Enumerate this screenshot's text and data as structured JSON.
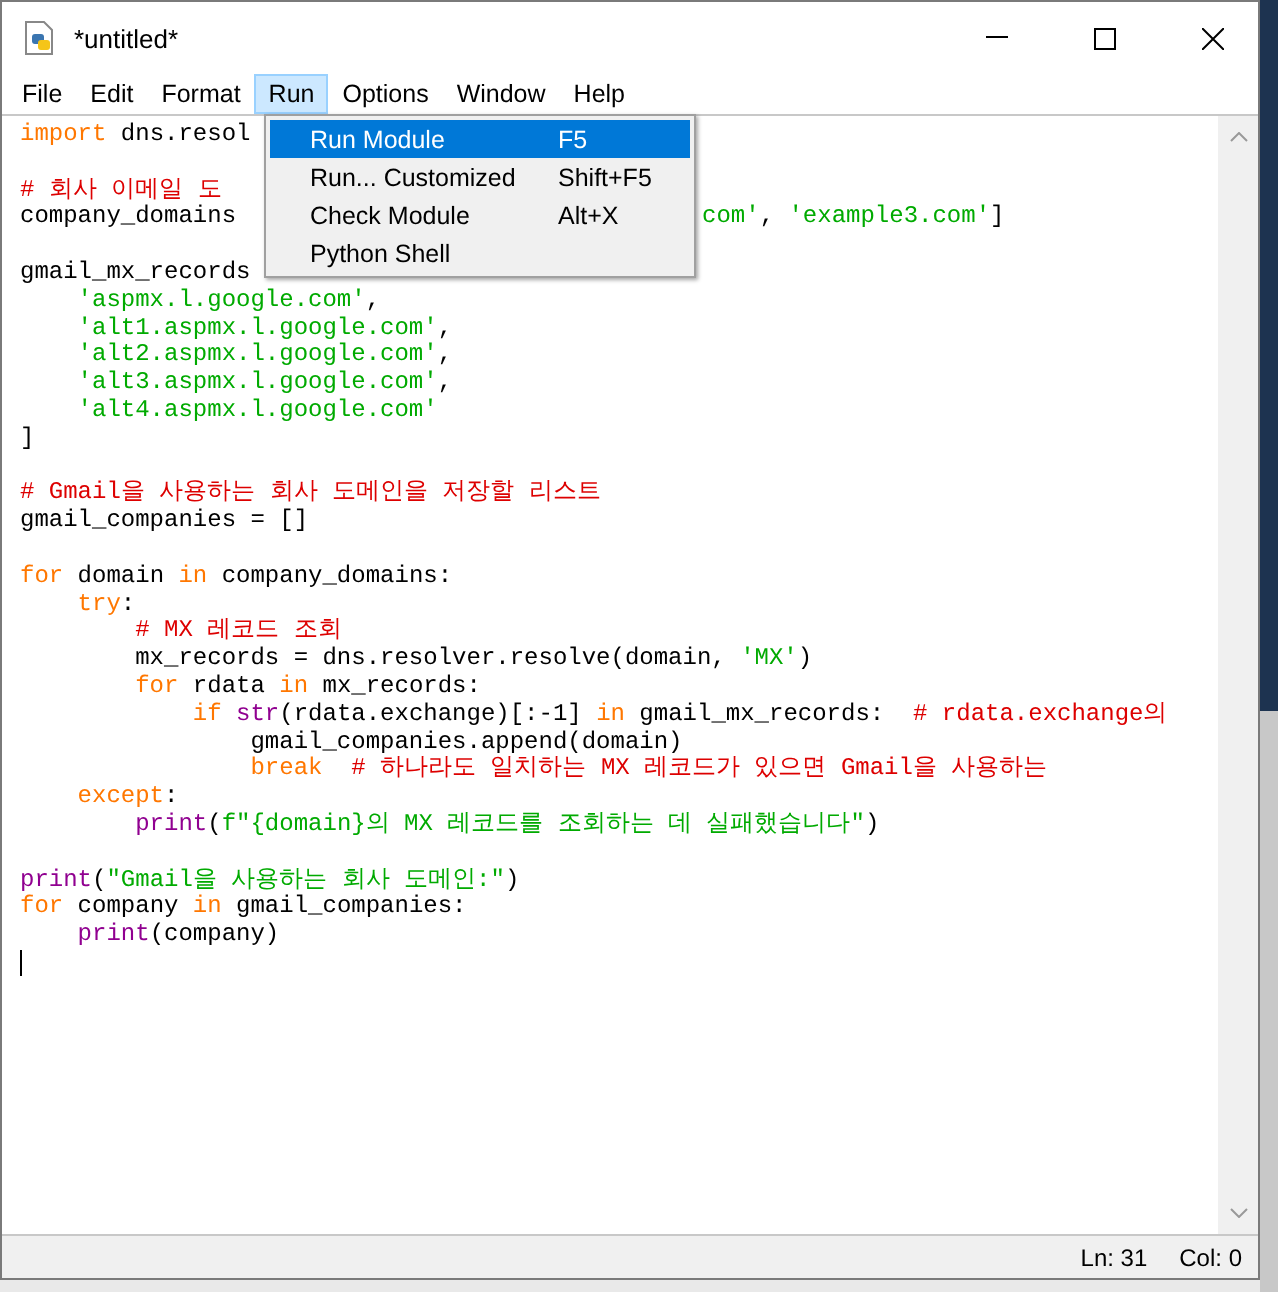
{
  "window": {
    "title": "*untitled*"
  },
  "menu_bar": [
    {
      "label": "File",
      "selected": false
    },
    {
      "label": "Edit",
      "selected": false
    },
    {
      "label": "Format",
      "selected": false
    },
    {
      "label": "Run",
      "selected": true
    },
    {
      "label": "Options",
      "selected": false
    },
    {
      "label": "Window",
      "selected": false
    },
    {
      "label": "Help",
      "selected": false
    }
  ],
  "run_menu": [
    {
      "label": "Run Module",
      "shortcut": "F5",
      "selected": true
    },
    {
      "label": "Run... Customized",
      "shortcut": "Shift+F5",
      "selected": false
    },
    {
      "label": "Check Module",
      "shortcut": "Alt+X",
      "selected": false
    },
    {
      "label": "Python Shell",
      "selected": false
    }
  ],
  "editor": {
    "lines": [
      {
        "tokens": [
          {
            "kind": "keyword",
            "text": "import"
          },
          {
            "kind": "plain",
            "text": " dns.resol"
          }
        ]
      },
      {
        "kind": "blank"
      },
      {
        "tokens": [
          {
            "kind": "comment",
            "text": "# 회사 이메일 도"
          }
        ]
      },
      {
        "kind": "split",
        "tokens": [
          {
            "kind": "plain",
            "text": "company_domains"
          }
        ],
        "tail": [
          {
            "kind": "string",
            "text": "com'"
          },
          {
            "kind": "plain",
            "text": ", "
          },
          {
            "kind": "string",
            "text": "'example3.com'"
          },
          {
            "kind": "plain",
            "text": "]"
          }
        ]
      },
      {
        "kind": "blank"
      },
      {
        "tokens": [
          {
            "kind": "plain",
            "text": "gmail_mx_records"
          }
        ]
      },
      {
        "tokens": [
          {
            "kind": "string",
            "text": "    'aspmx.l.google.com'"
          },
          {
            "kind": "plain",
            "text": ","
          }
        ]
      },
      {
        "tokens": [
          {
            "kind": "string",
            "text": "    'alt1.aspmx.l.google.com'"
          },
          {
            "kind": "plain",
            "text": ","
          }
        ]
      },
      {
        "tokens": [
          {
            "kind": "string",
            "text": "    'alt2.aspmx.l.google.com'"
          },
          {
            "kind": "plain",
            "text": ","
          }
        ]
      },
      {
        "tokens": [
          {
            "kind": "string",
            "text": "    'alt3.aspmx.l.google.com'"
          },
          {
            "kind": "plain",
            "text": ","
          }
        ]
      },
      {
        "tokens": [
          {
            "kind": "string",
            "text": "    'alt4.aspmx.l.google.com'"
          }
        ]
      },
      {
        "tokens": [
          {
            "kind": "plain",
            "text": "]"
          }
        ]
      },
      {
        "kind": "blank"
      },
      {
        "tokens": [
          {
            "kind": "comment",
            "text": "# Gmail을 사용하는 회사 도메인을 저장할 리스트"
          }
        ]
      },
      {
        "tokens": [
          {
            "kind": "plain",
            "text": "gmail_companies = []"
          }
        ]
      },
      {
        "kind": "blank"
      },
      {
        "tokens": [
          {
            "kind": "keyword",
            "text": "for"
          },
          {
            "kind": "plain",
            "text": " domain "
          },
          {
            "kind": "keyword",
            "text": "in"
          },
          {
            "kind": "plain",
            "text": " company_domains:"
          }
        ]
      },
      {
        "tokens": [
          {
            "kind": "keyword",
            "text": "    try"
          },
          {
            "kind": "plain",
            "text": ":"
          }
        ]
      },
      {
        "tokens": [
          {
            "kind": "comment",
            "text": "        # MX 레코드 조회"
          }
        ]
      },
      {
        "tokens": [
          {
            "kind": "plain",
            "text": "        mx_records = dns.resolver.resolve(domain, "
          },
          {
            "kind": "string",
            "text": "'MX'"
          },
          {
            "kind": "plain",
            "text": ")"
          }
        ]
      },
      {
        "tokens": [
          {
            "kind": "keyword",
            "text": "        for"
          },
          {
            "kind": "plain",
            "text": " rdata "
          },
          {
            "kind": "keyword",
            "text": "in"
          },
          {
            "kind": "plain",
            "text": " mx_records:"
          }
        ]
      },
      {
        "tokens": [
          {
            "kind": "keyword",
            "text": "            if"
          },
          {
            "kind": "builtin",
            "text": " str"
          },
          {
            "kind": "plain",
            "text": "(rdata.exchange)[:-1] "
          },
          {
            "kind": "keyword",
            "text": "in"
          },
          {
            "kind": "plain",
            "text": " gmail_mx_records:  "
          },
          {
            "kind": "comment",
            "text": "# rdata.exchange의"
          }
        ]
      },
      {
        "tokens": [
          {
            "kind": "plain",
            "text": "                gmail_companies.append(domain)"
          }
        ]
      },
      {
        "tokens": [
          {
            "kind": "keyword",
            "text": "                break"
          },
          {
            "kind": "comment",
            "text": "  # 하나라도 일치하는 MX 레코드가 있으면 Gmail을 사용하는"
          }
        ]
      },
      {
        "tokens": [
          {
            "kind": "keyword",
            "text": "    except"
          },
          {
            "kind": "plain",
            "text": ":"
          }
        ]
      },
      {
        "tokens": [
          {
            "kind": "builtin",
            "text": "        print"
          },
          {
            "kind": "plain",
            "text": "("
          },
          {
            "kind": "string",
            "text": "f\"{domain}의 MX 레코드를 조회하는 데 실패했습니다\""
          },
          {
            "kind": "plain",
            "text": ")"
          }
        ]
      },
      {
        "kind": "blank"
      },
      {
        "tokens": [
          {
            "kind": "builtin",
            "text": "print"
          },
          {
            "kind": "plain",
            "text": "("
          },
          {
            "kind": "string",
            "text": "\"Gmail을 사용하는 회사 도메인:\""
          },
          {
            "kind": "plain",
            "text": ")"
          }
        ]
      },
      {
        "tokens": [
          {
            "kind": "keyword",
            "text": "for"
          },
          {
            "kind": "plain",
            "text": " company "
          },
          {
            "kind": "keyword",
            "text": "in"
          },
          {
            "kind": "plain",
            "text": " gmail_companies:"
          }
        ]
      },
      {
        "tokens": [
          {
            "kind": "builtin",
            "text": "    print"
          },
          {
            "kind": "plain",
            "text": "(company)"
          }
        ]
      },
      {
        "kind": "cursor"
      }
    ]
  },
  "status_bar": {
    "line": "Ln: 31",
    "col": "Col: 0"
  }
}
